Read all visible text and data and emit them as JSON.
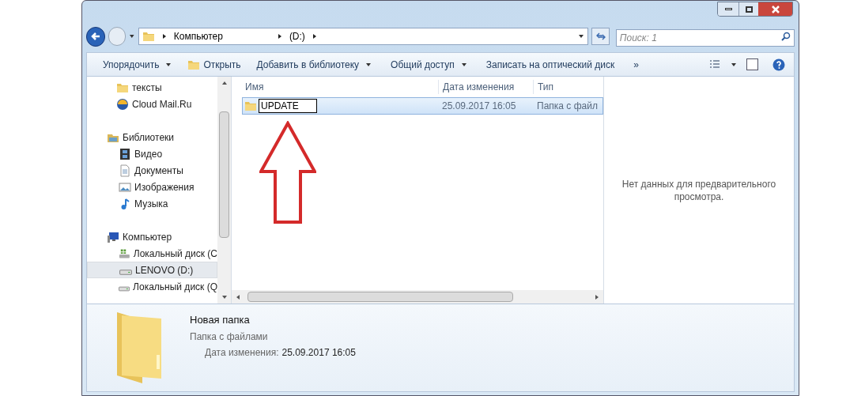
{
  "address": {
    "crumbs": [
      "Компьютер",
      "(D:)"
    ]
  },
  "search": {
    "placeholder": "Поиск: 1"
  },
  "toolbar": [
    {
      "label": "Упорядочить",
      "kind": "menu"
    },
    {
      "label": "Открыть",
      "kind": "open"
    },
    {
      "label": "Добавить в библиотеку",
      "kind": "menu"
    },
    {
      "label": "Общий доступ",
      "kind": "menu"
    },
    {
      "label": "Записать на оптический диск",
      "kind": "plain"
    },
    {
      "label": "»",
      "kind": "plain"
    }
  ],
  "sidebar": {
    "groups": [
      {
        "items": [
          {
            "label": "тексты",
            "kind": "folder",
            "selected": false
          },
          {
            "label": "Cloud Mail.Ru",
            "kind": "cloud",
            "selected": false
          }
        ]
      },
      {
        "label": "Библиотеки",
        "kind": "library",
        "items": [
          {
            "label": "Видео",
            "kind": "video",
            "selected": false
          },
          {
            "label": "Документы",
            "kind": "docs",
            "selected": false
          },
          {
            "label": "Изображения",
            "kind": "images",
            "selected": false
          },
          {
            "label": "Музыка",
            "kind": "music",
            "selected": false
          }
        ]
      },
      {
        "label": "Компьютер",
        "kind": "computer",
        "items": [
          {
            "label": "Локальный диск (C",
            "kind": "system-drive",
            "selected": false
          },
          {
            "label": "LENOVO (D:)",
            "kind": "drive",
            "selected": true
          },
          {
            "label": "Локальный диск (Q",
            "kind": "drive",
            "selected": false
          }
        ]
      }
    ]
  },
  "table": {
    "columns": [
      "Имя",
      "Дата изменения",
      "Тип"
    ],
    "rows": [
      {
        "name": "UPDATE",
        "date": "25.09.2017 16:05",
        "type": "Папка с файл",
        "selected": true,
        "renaming": true
      }
    ]
  },
  "preview": {
    "message": "Нет данных для предварительного просмотра."
  },
  "details": {
    "name": "Новая папка",
    "type": "Папка с файлами",
    "date_label": "Дата изменения:",
    "date": "25.09.2017 16:05"
  }
}
